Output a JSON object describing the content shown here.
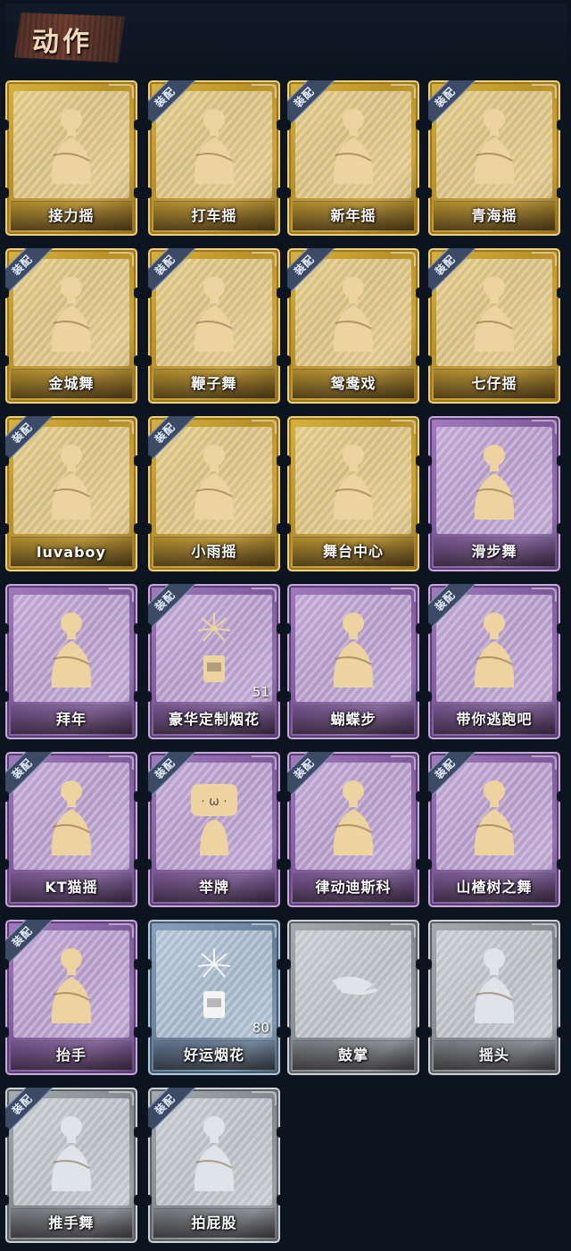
{
  "page": {
    "title": "动作",
    "equip_label": "装配"
  },
  "colors": {
    "gold": "#c9a53a",
    "purple": "#8a66a8",
    "blue": "#6f88a3",
    "silver": "#8d9298"
  },
  "cards": [
    {
      "name": "接力摇",
      "rarity": "gold",
      "equipped": false,
      "count": null,
      "icon": "dancer-figure-icon"
    },
    {
      "name": "打车摇",
      "rarity": "gold",
      "equipped": true,
      "count": null,
      "icon": "dancer-figure-icon"
    },
    {
      "name": "新年摇",
      "rarity": "gold",
      "equipped": true,
      "count": null,
      "icon": "dancer-figure-icon"
    },
    {
      "name": "青海摇",
      "rarity": "gold",
      "equipped": true,
      "count": null,
      "icon": "dancer-figure-icon"
    },
    {
      "name": "金城舞",
      "rarity": "gold",
      "equipped": true,
      "count": null,
      "icon": "dancer-figure-icon"
    },
    {
      "name": "鞭子舞",
      "rarity": "gold",
      "equipped": true,
      "count": null,
      "icon": "dancer-figure-icon"
    },
    {
      "name": "鸳鸯戏",
      "rarity": "gold",
      "equipped": true,
      "count": null,
      "icon": "dancer-figure-icon"
    },
    {
      "name": "七仔摇",
      "rarity": "gold",
      "equipped": true,
      "count": null,
      "icon": "dancer-figure-icon"
    },
    {
      "name": "luvaboy",
      "rarity": "gold",
      "equipped": true,
      "count": null,
      "icon": "dancer-figure-icon"
    },
    {
      "name": "小雨摇",
      "rarity": "gold",
      "equipped": true,
      "count": null,
      "icon": "dancer-figure-icon"
    },
    {
      "name": "舞台中心",
      "rarity": "gold",
      "equipped": false,
      "count": null,
      "icon": "dancer-figure-icon"
    },
    {
      "name": "滑步舞",
      "rarity": "purple",
      "equipped": false,
      "count": null,
      "icon": "dancer-figure-icon"
    },
    {
      "name": "拜年",
      "rarity": "purple",
      "equipped": false,
      "count": null,
      "icon": "dancer-figure-icon"
    },
    {
      "name": "豪华定制烟花",
      "rarity": "purple",
      "equipped": true,
      "count": "51",
      "icon": "fireworks-icon"
    },
    {
      "name": "蝴蝶步",
      "rarity": "purple",
      "equipped": false,
      "count": null,
      "icon": "dancer-figure-icon"
    },
    {
      "name": "带你逃跑吧",
      "rarity": "purple",
      "equipped": true,
      "count": null,
      "icon": "dancer-figure-icon"
    },
    {
      "name": "KT猫摇",
      "rarity": "purple",
      "equipped": true,
      "count": null,
      "icon": "dancer-figure-icon"
    },
    {
      "name": "举牌",
      "rarity": "purple",
      "equipped": true,
      "count": null,
      "icon": "sign-holder-icon"
    },
    {
      "name": "律动迪斯科",
      "rarity": "purple",
      "equipped": true,
      "count": null,
      "icon": "dancer-figure-icon"
    },
    {
      "name": "山楂树之舞",
      "rarity": "purple",
      "equipped": true,
      "count": null,
      "icon": "dancer-figure-icon"
    },
    {
      "name": "抬手",
      "rarity": "purple",
      "equipped": true,
      "count": null,
      "icon": "dancer-figure-icon"
    },
    {
      "name": "好运烟花",
      "rarity": "blue",
      "equipped": false,
      "count": "80",
      "icon": "fireworks-icon"
    },
    {
      "name": "鼓掌",
      "rarity": "silver",
      "equipped": false,
      "count": null,
      "icon": "clapping-hands-icon"
    },
    {
      "name": "摇头",
      "rarity": "silver",
      "equipped": false,
      "count": null,
      "icon": "dancer-figure-icon"
    },
    {
      "name": "推手舞",
      "rarity": "silver",
      "equipped": true,
      "count": null,
      "icon": "dancer-figure-icon"
    },
    {
      "name": "拍屁股",
      "rarity": "silver",
      "equipped": true,
      "count": null,
      "icon": "dancer-figure-icon"
    }
  ]
}
